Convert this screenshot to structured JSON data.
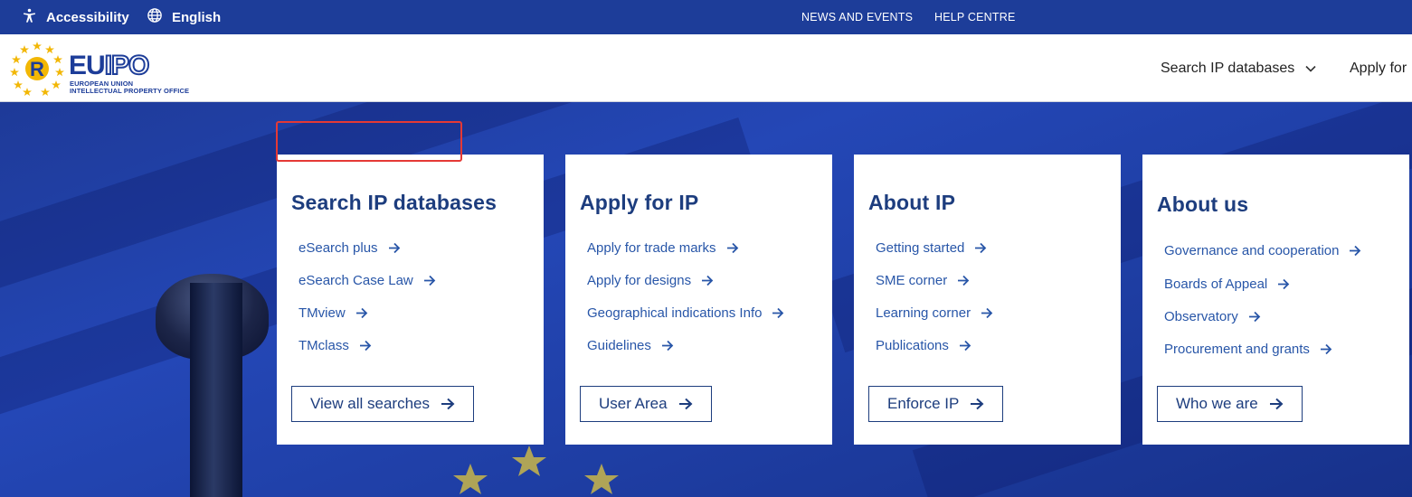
{
  "topbar": {
    "accessibility_label": "Accessibility",
    "language_label": "English",
    "news_label": "NEWS AND EVENTS",
    "help_label": "HELP CENTRE"
  },
  "header": {
    "logo_main": "EU",
    "logo_accent": "IPO",
    "logo_sub_line1": "EUROPEAN UNION",
    "logo_sub_line2": "INTELLECTUAL PROPERTY OFFICE",
    "nav": [
      {
        "label": "Search IP databases"
      },
      {
        "label": "Apply for"
      }
    ]
  },
  "cards": [
    {
      "title": "Search IP databases",
      "links": [
        "eSearch plus",
        "eSearch Case Law",
        "TMview",
        "TMclass"
      ],
      "button": "View all searches"
    },
    {
      "title": "Apply for IP",
      "links": [
        "Apply for trade marks",
        "Apply for designs",
        "Geographical indications Info",
        "Guidelines"
      ],
      "button": "User Area"
    },
    {
      "title": "About IP",
      "links": [
        "Getting started",
        "SME corner",
        "Learning corner",
        "Publications"
      ],
      "button": "Enforce IP"
    },
    {
      "title": "About us",
      "links": [
        "Governance and cooperation",
        "Boards of Appeal",
        "Observatory",
        "Procurement and grants"
      ],
      "button": "Who we are"
    }
  ],
  "colors": {
    "brand_blue": "#1d3d99",
    "link_blue": "#2856a8",
    "title_blue": "#1d3d7e",
    "highlight_red": "#e53935"
  }
}
